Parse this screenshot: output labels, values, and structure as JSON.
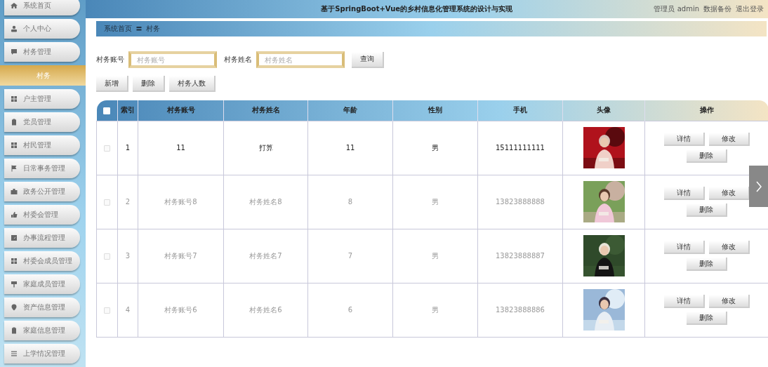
{
  "sidebar": {
    "items": [
      {
        "label": "系统首页",
        "kind": "menu",
        "selected": false
      },
      {
        "label": "个人中心",
        "kind": "menu",
        "selected": false
      },
      {
        "label": "村务管理",
        "kind": "menu",
        "selected": false
      },
      {
        "label": "村务",
        "kind": "sub",
        "selected": true
      },
      {
        "label": "户主管理",
        "kind": "menu",
        "selected": false
      },
      {
        "label": "党员管理",
        "kind": "menu",
        "selected": false
      },
      {
        "label": "村民管理",
        "kind": "menu",
        "selected": false
      },
      {
        "label": "日常事务管理",
        "kind": "menu",
        "selected": false
      },
      {
        "label": "政务公开管理",
        "kind": "menu",
        "selected": false
      },
      {
        "label": "村委会管理",
        "kind": "menu",
        "selected": false
      },
      {
        "label": "办事流程管理",
        "kind": "menu",
        "selected": false
      },
      {
        "label": "村委会成员管理",
        "kind": "menu",
        "selected": false
      },
      {
        "label": "家庭成员管理",
        "kind": "menu",
        "selected": false
      },
      {
        "label": "资产信息管理",
        "kind": "menu",
        "selected": false
      },
      {
        "label": "家庭信息管理",
        "kind": "menu",
        "selected": false
      },
      {
        "label": "上学情况管理",
        "kind": "menu",
        "selected": false
      }
    ]
  },
  "header": {
    "title": "基于SpringBoot+Vue的乡村信息化管理系统的设计与实现",
    "user": "管理员 admin",
    "links": [
      "数据备份",
      "退出登录"
    ]
  },
  "breadcrumb": [
    "系统首页",
    "村务"
  ],
  "breadcrumb_separator": "〓",
  "search": {
    "fields": [
      {
        "label": "村务账号",
        "placeholder": "村务账号"
      },
      {
        "label": "村务姓名",
        "placeholder": "村务姓名"
      }
    ],
    "button": "查询"
  },
  "actions": [
    "新增",
    "删除",
    "村务人数"
  ],
  "table": {
    "select_all_checked": false,
    "columns": [
      "索引",
      "村务账号",
      "村务姓名",
      "年龄",
      "性别",
      "手机",
      "头像",
      "操作"
    ],
    "rows": [
      {
        "checked": false,
        "emphasized": true,
        "cells": [
          "1",
          "11",
          "打算",
          "11",
          "男",
          "15111111111"
        ],
        "buttons": [
          "详情",
          "修改",
          "删除"
        ]
      },
      {
        "checked": false,
        "emphasized": false,
        "cells": [
          "2",
          "村务账号8",
          "村务姓名8",
          "8",
          "男",
          "13823888888"
        ],
        "buttons": [
          "详情",
          "修改",
          "删除"
        ]
      },
      {
        "checked": false,
        "emphasized": false,
        "cells": [
          "3",
          "村务账号7",
          "村务姓名7",
          "7",
          "男",
          "13823888887"
        ],
        "buttons": [
          "详情",
          "修改",
          "删除"
        ]
      },
      {
        "checked": false,
        "emphasized": false,
        "cells": [
          "4",
          "村务账号6",
          "村务姓名6",
          "6",
          "男",
          "13823888886"
        ],
        "buttons": [
          "详情",
          "修改",
          "删除"
        ]
      }
    ]
  }
}
